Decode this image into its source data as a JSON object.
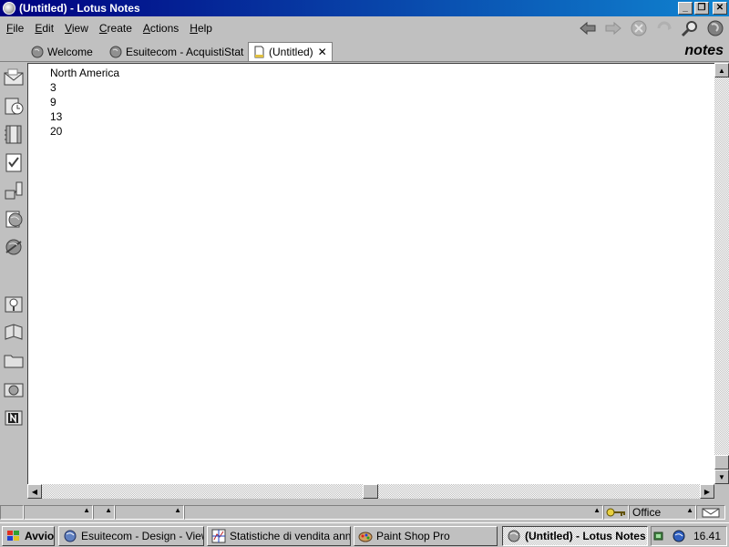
{
  "window": {
    "title": "(Untitled) - Lotus Notes",
    "controls": [
      "minimize",
      "restore",
      "close"
    ]
  },
  "menu": {
    "items": [
      {
        "label": "File",
        "mnemonic": "F",
        "rest": "ile"
      },
      {
        "label": "Edit",
        "mnemonic": "E",
        "rest": "dit"
      },
      {
        "label": "View",
        "mnemonic": "V",
        "rest": "iew"
      },
      {
        "label": "Create",
        "mnemonic": "C",
        "rest": "reate"
      },
      {
        "label": "Actions",
        "mnemonic": "A",
        "rest": "ctions"
      },
      {
        "label": "Help",
        "mnemonic": "H",
        "rest": "elp"
      }
    ]
  },
  "toolbar": {
    "icons": [
      "back-arrow-icon",
      "forward-arrow-icon",
      "stop-icon",
      "refresh-icon",
      "search-icon",
      "globe-icon"
    ]
  },
  "tabs": [
    {
      "label": "Welcome",
      "icon": "globe-icon",
      "active": false
    },
    {
      "label": "Esuitecom - AcquistiStat",
      "icon": "globe-icon",
      "active": false
    },
    {
      "label": "(Untitled)",
      "icon": "document-icon",
      "active": true,
      "close": "✕"
    }
  ],
  "brand": "notes",
  "sidebar": {
    "bookmarks": [
      "mail-icon",
      "calendar-icon",
      "address-book-icon",
      "todo-icon",
      "replicator-icon",
      "web-browser-icon",
      "databases-icon",
      "favorites-icon",
      "bookmark-book-icon",
      "folder-icon",
      "databases-globe-icon",
      "notes-app-icon"
    ]
  },
  "document": {
    "lines": [
      "North America",
      "3",
      "9",
      "13",
      "20"
    ]
  },
  "status": {
    "location": "Office"
  },
  "taskbar": {
    "start": "Avvio",
    "tasks": [
      {
        "label": "Esuitecom - Design - View...",
        "pressed": false
      },
      {
        "label": "Statistiche di vendita anno...",
        "pressed": false
      },
      {
        "label": "Paint Shop Pro",
        "pressed": false
      },
      {
        "label": "(Untitled) - Lotus Notes",
        "pressed": true
      }
    ],
    "clock": "16.41"
  }
}
